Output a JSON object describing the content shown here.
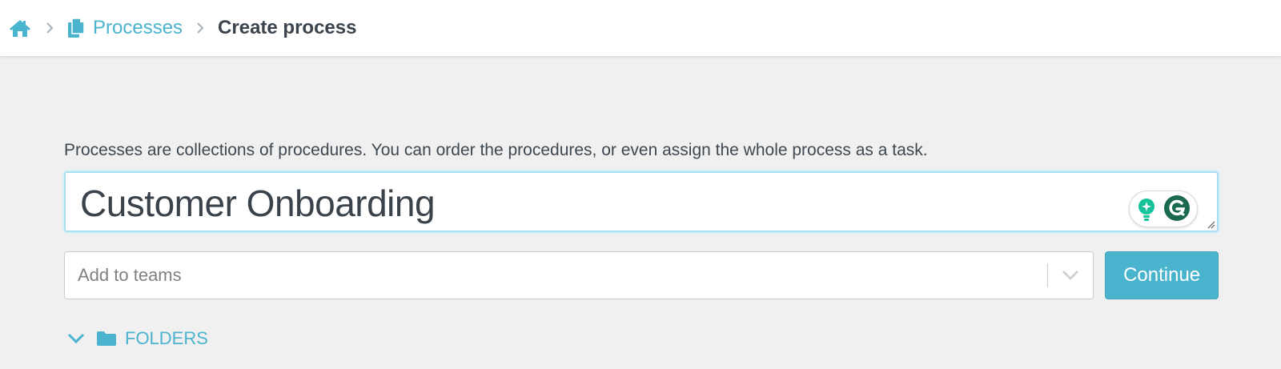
{
  "breadcrumb": {
    "home_icon": "home-icon",
    "separator_icon": "chevron-right-icon",
    "processes_icon": "documents-icon",
    "processes_label": "Processes",
    "current_label": "Create process"
  },
  "form": {
    "description": "Processes are collections of procedures. You can order the procedures, or even assign the whole process as a task.",
    "title_value": "Customer Onboarding",
    "teams_placeholder": "Add to teams",
    "continue_label": "Continue"
  },
  "folders": {
    "label": "FOLDERS",
    "expanded": true
  },
  "colors": {
    "accent": "#4ab3cd",
    "text": "#3f4851",
    "background": "#f0f0f0",
    "grammarly_green": "#15c39a",
    "grammarly_dark": "#1b6a4f"
  }
}
